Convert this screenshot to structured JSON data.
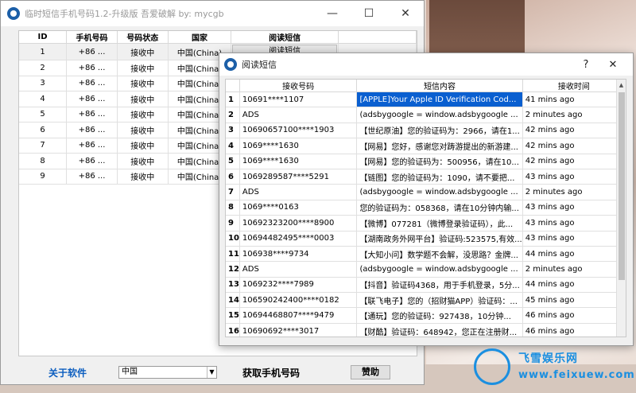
{
  "main_window": {
    "title": "临时短信手机号码1.2-升级版 吾爱破解 by: mycgb",
    "controls": {
      "minimize": "—",
      "maximize": "☐",
      "close": "✕"
    },
    "columns": [
      "ID",
      "手机号码",
      "号码状态",
      "国家",
      "阅读短信"
    ],
    "rows": [
      {
        "id": "1",
        "phone": "+86 ...",
        "status": "接收中",
        "country": "中国(China)",
        "read": "阅读短信"
      },
      {
        "id": "2",
        "phone": "+86 ...",
        "status": "接收中",
        "country": "中国(China)",
        "read": ""
      },
      {
        "id": "3",
        "phone": "+86 ...",
        "status": "接收中",
        "country": "中国(China)",
        "read": ""
      },
      {
        "id": "4",
        "phone": "+86 ...",
        "status": "接收中",
        "country": "中国(China)",
        "read": ""
      },
      {
        "id": "5",
        "phone": "+86 ...",
        "status": "接收中",
        "country": "中国(China)",
        "read": ""
      },
      {
        "id": "6",
        "phone": "+86 ...",
        "status": "接收中",
        "country": "中国(China)",
        "read": ""
      },
      {
        "id": "7",
        "phone": "+86 ...",
        "status": "接收中",
        "country": "中国(China)",
        "read": ""
      },
      {
        "id": "8",
        "phone": "+86 ...",
        "status": "接收中",
        "country": "中国(China)",
        "read": ""
      },
      {
        "id": "9",
        "phone": "+86 ...",
        "status": "接收中",
        "country": "中国(China)",
        "read": ""
      }
    ],
    "bottom": {
      "about_label": "关于软件",
      "country_select_value": "中国",
      "get_number_label": "获取手机号码",
      "donate_label": "赞助"
    }
  },
  "dialog": {
    "title": "阅读短信",
    "help": "?",
    "close": "✕",
    "columns": [
      "接收号码",
      "短信内容",
      "接收时间"
    ],
    "rows": [
      {
        "n": "1",
        "from": "10691****1107",
        "content": "[APPLE]Your Apple ID Verification Cod...",
        "time": "41 mins ago"
      },
      {
        "n": "2",
        "from": "ADS",
        "content": "(adsbygoogle = window.adsbygoogle ...",
        "time": "2 minutes ago"
      },
      {
        "n": "3",
        "from": "10690657100****1903",
        "content": "【世纪原油】您的验证码为：2966，请在1...",
        "time": "42 mins ago"
      },
      {
        "n": "4",
        "from": "1069****1630",
        "content": "【网易】您好，感谢您对踌游提出的新游建...",
        "time": "42 mins ago"
      },
      {
        "n": "5",
        "from": "1069****1630",
        "content": "【网易】您的验证码为：500956，请在10...",
        "time": "42 mins ago"
      },
      {
        "n": "6",
        "from": "1069289587****5291",
        "content": "【链图】您的验证码为：1090，请不要把...",
        "time": "43 mins ago"
      },
      {
        "n": "7",
        "from": "ADS",
        "content": "(adsbygoogle = window.adsbygoogle ...",
        "time": "2 minutes ago"
      },
      {
        "n": "8",
        "from": "1069****0163",
        "content": "您的验证码为：058368，请在10分钟内输...",
        "time": "43 mins ago"
      },
      {
        "n": "9",
        "from": "10692323200****8900",
        "content": "【微博】077281（微博登录验证码），此...",
        "time": "43 mins ago"
      },
      {
        "n": "10",
        "from": "10694482495****0003",
        "content": "【湖南政务外网平台】验证码:523575,有效...",
        "time": "43 mins ago"
      },
      {
        "n": "11",
        "from": "106938****9734",
        "content": "【大知小问】数学题不会解，没思路？金牌...",
        "time": "44 mins ago"
      },
      {
        "n": "12",
        "from": "ADS",
        "content": "(adsbygoogle = window.adsbygoogle ...",
        "time": "2 minutes ago"
      },
      {
        "n": "13",
        "from": "1069232****7989",
        "content": "【抖音】验证码4368，用于手机登录，5分...",
        "time": "44 mins ago"
      },
      {
        "n": "14",
        "from": "106590242400****0182",
        "content": "【联飞电子】您的（招财猫APP）验证码：...",
        "time": "45 mins ago"
      },
      {
        "n": "15",
        "from": "10694468807****9479",
        "content": "【通玩】您的验证码：927438，10分钟...",
        "time": "46 mins ago"
      },
      {
        "n": "16",
        "from": "10690692****3017",
        "content": "【财酷】验证码：648942，您正在注册财...",
        "time": "46 mins ago"
      }
    ]
  },
  "watermark": {
    "line1": "飞雪娱乐网",
    "line2": "www.feixuew.com"
  }
}
